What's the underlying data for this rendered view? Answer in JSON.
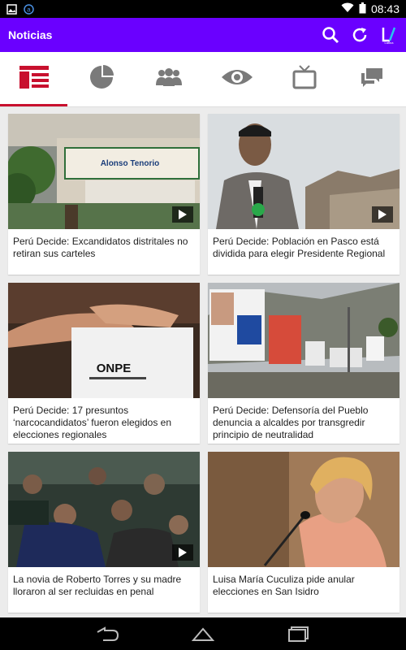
{
  "status_bar": {
    "time": "08:43",
    "icons": [
      "image-icon",
      "app-notification-icon",
      "wifi-icon",
      "battery-icon"
    ]
  },
  "app_bar": {
    "title": "Noticias",
    "actions": [
      "search-icon",
      "refresh-icon",
      "brand-logo-icon"
    ],
    "color": "#6a00ff"
  },
  "tabs": {
    "items": [
      {
        "icon": "news-icon",
        "active": true
      },
      {
        "icon": "pie-chart-icon",
        "active": false
      },
      {
        "icon": "people-icon",
        "active": false
      },
      {
        "icon": "eye-icon",
        "active": false
      },
      {
        "icon": "tv-icon",
        "active": false
      },
      {
        "icon": "chat-icon",
        "active": false
      }
    ],
    "accent": "#c8102e"
  },
  "articles": [
    {
      "title": "Perú Decide: Excandidatos distritales no retiran sus carteles",
      "video": true
    },
    {
      "title": "Perú Decide: Población en Pasco está dividida para elegir Presidente Regional",
      "video": true
    },
    {
      "title": "Perú Decide: 17 presuntos ‘narcocandidatos’ fueron elegidos en elecciones regionales",
      "video": false
    },
    {
      "title": "Perú Decide: Defensoría del Pueblo denuncia a alcaldes por transgredir principio de neutralidad",
      "video": false
    },
    {
      "title": "La novia de Roberto Torres y su madre lloraron al ser recluidas en penal",
      "video": true
    },
    {
      "title": "Luisa María Cuculiza pide anular elecciones en San Isidro",
      "video": false
    }
  ],
  "image_text": {
    "banner": "Alonso Tenorio",
    "onpe": "ONPE"
  }
}
